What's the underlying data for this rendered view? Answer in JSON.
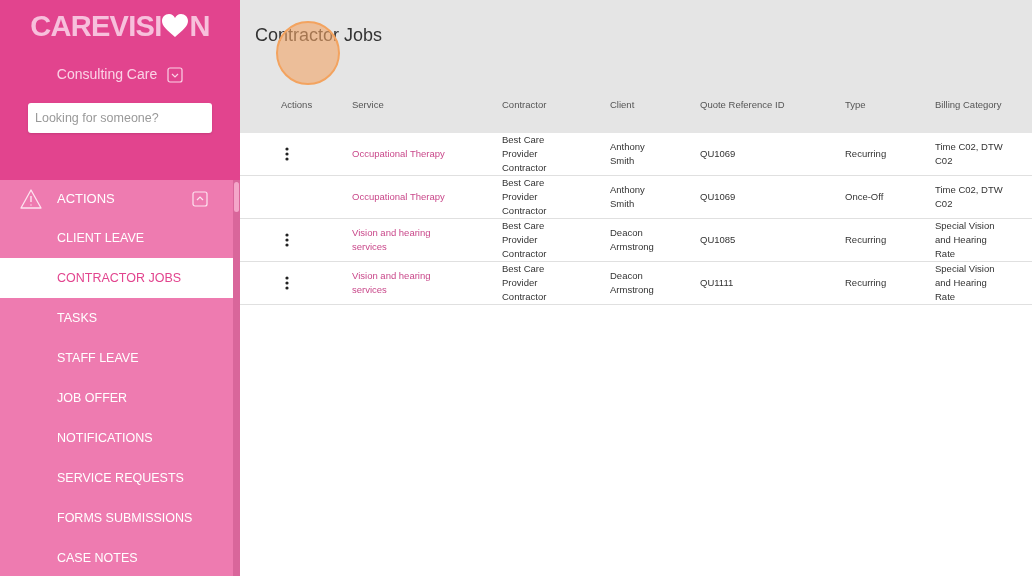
{
  "logo": {
    "parts": [
      "CAREVISI",
      "N"
    ]
  },
  "organisation": {
    "label": "Consulting Care",
    "expanded": false
  },
  "search": {
    "placeholder": "Looking for someone?"
  },
  "nav": {
    "section": {
      "label": "ACTIONS",
      "expanded": true
    },
    "items": [
      {
        "label": "CLIENT LEAVE",
        "selected": false
      },
      {
        "label": "CONTRACTOR JOBS",
        "selected": true
      },
      {
        "label": "TASKS",
        "selected": false
      },
      {
        "label": "STAFF LEAVE",
        "selected": false
      },
      {
        "label": "JOB OFFER",
        "selected": false
      },
      {
        "label": "NOTIFICATIONS",
        "selected": false
      },
      {
        "label": "SERVICE REQUESTS",
        "selected": false
      },
      {
        "label": "FORMS SUBMISSIONS",
        "selected": false
      },
      {
        "label": "CASE NOTES",
        "selected": false
      }
    ]
  },
  "page": {
    "title": "Contractor Jobs"
  },
  "table": {
    "columns": [
      "Actions",
      "Service",
      "Contractor",
      "Client",
      "Quote Reference ID",
      "Type",
      "Billing Category"
    ],
    "rows": [
      {
        "has_actions": true,
        "service": "Occupational Therapy",
        "contractor": "Best Care Provider Contractor",
        "client": "Anthony Smith",
        "quote_reference_id": "QU1069",
        "type": "Recurring",
        "billing_category": "Time C02, DTW C02"
      },
      {
        "has_actions": false,
        "service": "Occupational Therapy",
        "contractor": "Best Care Provider Contractor",
        "client": "Anthony Smith",
        "quote_reference_id": "QU1069",
        "type": "Once-Off",
        "billing_category": "Time C02, DTW C02"
      },
      {
        "has_actions": true,
        "service": "Vision and hearing services",
        "contractor": "Best Care Provider Contractor",
        "client": "Deacon Armstrong",
        "quote_reference_id": "QU1085",
        "type": "Recurring",
        "billing_category": "Special Vision and Hearing Rate"
      },
      {
        "has_actions": true,
        "service": "Vision and hearing services",
        "contractor": "Best Care Provider Contractor",
        "client": "Deacon Armstrong",
        "quote_reference_id": "QU1111",
        "type": "Recurring",
        "billing_category": "Special Vision and Hearing Rate"
      }
    ]
  }
}
